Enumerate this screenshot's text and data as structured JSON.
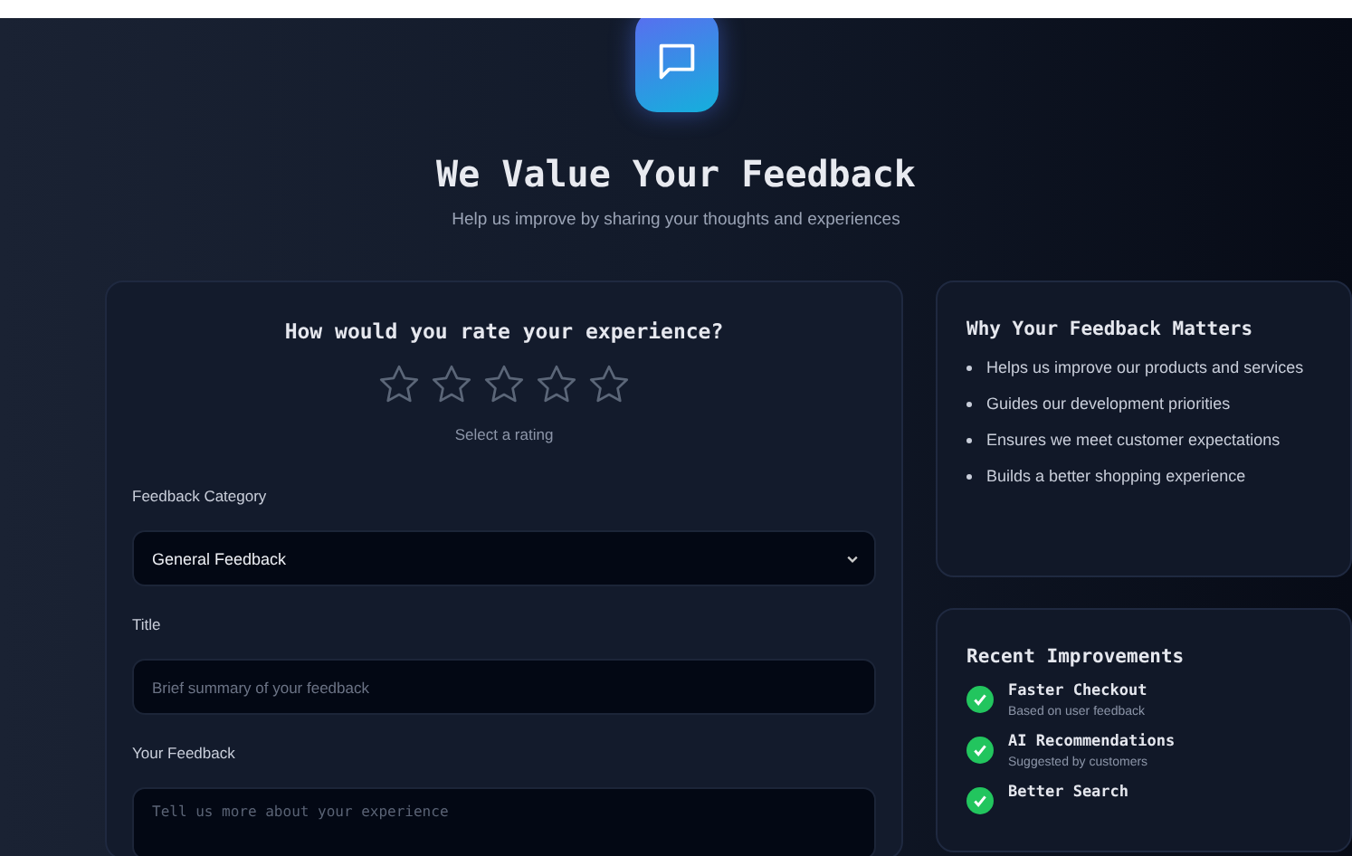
{
  "header": {
    "title": "We Value Your Feedback",
    "subtitle": "Help us improve by sharing your thoughts and experiences"
  },
  "rating": {
    "question": "How would you rate your experience?",
    "stars": 0,
    "hint": "Select a rating"
  },
  "form": {
    "category": {
      "label": "Feedback Category",
      "value": "General Feedback"
    },
    "title": {
      "label": "Title",
      "placeholder": "Brief summary of your feedback"
    },
    "feedback": {
      "label": "Your Feedback",
      "placeholder": "Tell us more about your experience"
    }
  },
  "why": {
    "title": "Why Your Feedback Matters",
    "items": [
      "Helps us improve our products and services",
      "Guides our development priorities",
      "Ensures we meet customer expectations",
      "Builds a better shopping experience"
    ]
  },
  "improvements": {
    "title": "Recent Improvements",
    "items": [
      {
        "title": "Faster Checkout",
        "note": "Based on user feedback"
      },
      {
        "title": "AI Recommendations",
        "note": "Suggested by customers"
      },
      {
        "title": "Better Search"
      }
    ]
  }
}
